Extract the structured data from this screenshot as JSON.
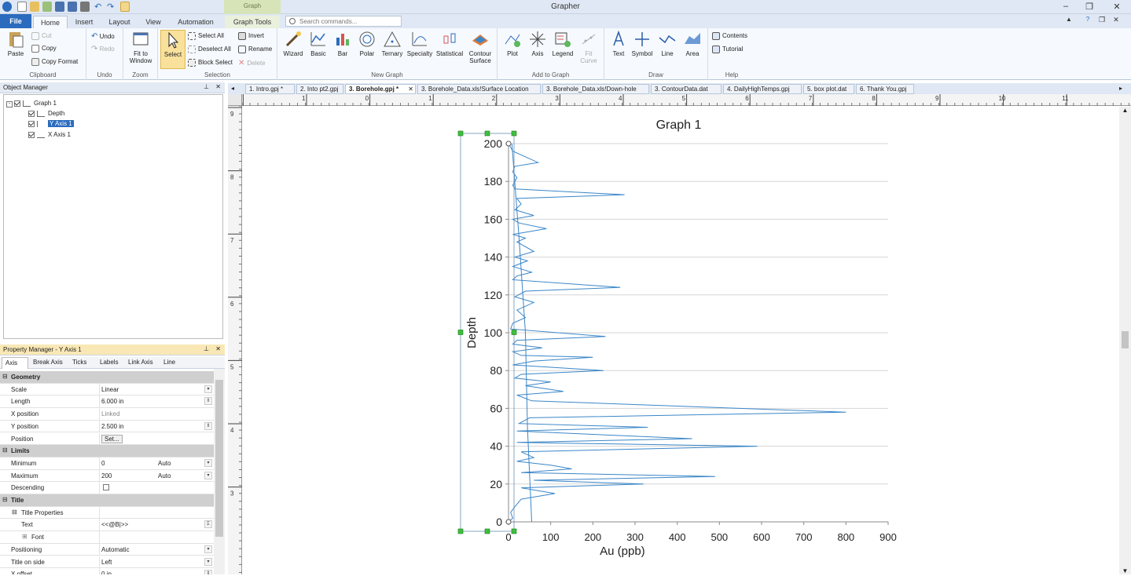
{
  "app": {
    "title": "Grapher",
    "context_tab": "Graph"
  },
  "ribbon_tabs": [
    "File",
    "Home",
    "Insert",
    "Layout",
    "View",
    "Automation",
    "Graph Tools"
  ],
  "search": {
    "placeholder": "Search commands..."
  },
  "ribbon": {
    "clipboard": {
      "label": "Clipboard",
      "paste": "Paste",
      "cut": "Cut",
      "copy": "Copy",
      "copy_format": "Copy Format"
    },
    "undo": {
      "label": "Undo",
      "undo": "Undo",
      "redo": "Redo"
    },
    "zoom": {
      "label": "Zoom",
      "fit_to_window_1": "Fit to",
      "fit_to_window_2": "Window"
    },
    "selection": {
      "label": "Selection",
      "select": "Select",
      "select_all": "Select All",
      "deselect_all": "Deselect All",
      "block_select": "Block Select",
      "invert": "Invert",
      "rename": "Rename",
      "delete": "Delete"
    },
    "new_graph": {
      "label": "New Graph",
      "items": [
        "Wizard",
        "Basic",
        "Bar",
        "Polar",
        "Ternary",
        "Specialty",
        "Statistical",
        "Contour"
      ],
      "contour_sub": "Surface"
    },
    "add_to_graph": {
      "label": "Add to Graph",
      "items": [
        "Plot",
        "Axis",
        "Legend",
        "Fit"
      ],
      "fit_sub": "Curve"
    },
    "draw": {
      "label": "Draw",
      "items": [
        "Text",
        "Symbol",
        "Line",
        "Area"
      ]
    },
    "help": {
      "label": "Help",
      "contents": "Contents",
      "tutorial": "Tutorial"
    }
  },
  "object_manager": {
    "title": "Object Manager",
    "tree": [
      "Graph 1",
      "Depth",
      "Y Axis 1",
      "X Axis 1"
    ]
  },
  "property_manager": {
    "title": "Property Manager - Y Axis 1",
    "tabs": [
      "Axis",
      "Break Axis",
      "Ticks",
      "Labels",
      "Link Axis",
      "Line"
    ],
    "rows": [
      {
        "type": "cat",
        "label": "Geometry"
      },
      {
        "label": "Scale",
        "value": "Linear",
        "dd": true
      },
      {
        "label": "Length",
        "value": "6.000 in",
        "spin": true
      },
      {
        "label": "X position",
        "value": "Linked",
        "muted": true
      },
      {
        "label": "Y position",
        "value": "2.500 in",
        "spin": true
      },
      {
        "label": "Position",
        "value": "Set...",
        "button": true
      },
      {
        "type": "cat",
        "label": "Limits"
      },
      {
        "label": "Minimum",
        "value": "0",
        "value2": "Auto",
        "dd": true
      },
      {
        "label": "Maximum",
        "value": "200",
        "value2": "Auto",
        "dd": true
      },
      {
        "label": "Descending",
        "checkbox": true
      },
      {
        "type": "cat",
        "label": "Title"
      },
      {
        "label": "Title Properties",
        "sub": true
      },
      {
        "label": "Text",
        "value": "<<@B|>>",
        "sigma": true,
        "indent": 2
      },
      {
        "label": "Font",
        "indent": 2,
        "plus": true
      },
      {
        "label": "Positioning",
        "value": "Automatic",
        "dd": true
      },
      {
        "label": "Title on side",
        "value": "Left",
        "dd": true
      },
      {
        "label": "X offset",
        "value": "0 in",
        "spin": true
      }
    ]
  },
  "doc_tabs": [
    "1. Intro.gpj *",
    "2. Into pt2.gpj",
    "3. Borehole.gpj *",
    "3. Borehole_Data.xls!Surface Location",
    "3. Borehole_Data.xls!Down-hole",
    "3. ContourData.dat",
    "4. DailyHighTemps.gpj",
    "5. box plot.dat",
    "6. Thank You.gpj"
  ],
  "ruler": {
    "h_labels": [
      "2",
      "1",
      "0",
      "1",
      "2",
      "3",
      "4",
      "5",
      "6",
      "7",
      "8",
      "9",
      "10",
      "11"
    ],
    "v_labels": [
      "9",
      "8",
      "7",
      "6",
      "5",
      "4",
      "3"
    ]
  },
  "chart_data": {
    "type": "line",
    "title": "Graph 1",
    "xlabel": "Au (ppb)",
    "ylabel": "Depth",
    "xlim": [
      0,
      900
    ],
    "ylim": [
      0,
      200
    ],
    "x_ticks": [
      "0",
      "100",
      "200",
      "300",
      "400",
      "500",
      "600",
      "700",
      "800",
      "900"
    ],
    "y_ticks": [
      "0",
      "20",
      "40",
      "60",
      "80",
      "100",
      "120",
      "140",
      "160",
      "180",
      "200"
    ],
    "grid": true,
    "series": [
      {
        "color": "#3a86c8",
        "points": [
          [
            0,
            200
          ],
          [
            5,
            198
          ],
          [
            10,
            196
          ],
          [
            70,
            190
          ],
          [
            15,
            188
          ],
          [
            10,
            185
          ],
          [
            20,
            182
          ],
          [
            10,
            178
          ],
          [
            15,
            176
          ],
          [
            275,
            173
          ],
          [
            20,
            171
          ],
          [
            30,
            168
          ],
          [
            15,
            165
          ],
          [
            60,
            162
          ],
          [
            10,
            160
          ],
          [
            25,
            158
          ],
          [
            90,
            155
          ],
          [
            10,
            152
          ],
          [
            40,
            150
          ],
          [
            20,
            148
          ],
          [
            60,
            143
          ],
          [
            15,
            140
          ],
          [
            45,
            138
          ],
          [
            10,
            135
          ],
          [
            55,
            132
          ],
          [
            20,
            130
          ],
          [
            10,
            128
          ],
          [
            265,
            124
          ],
          [
            40,
            122
          ],
          [
            15,
            119
          ],
          [
            60,
            116
          ],
          [
            20,
            112
          ],
          [
            40,
            108
          ],
          [
            10,
            105
          ],
          [
            5,
            102
          ],
          [
            230,
            98
          ],
          [
            20,
            96
          ],
          [
            10,
            94
          ],
          [
            80,
            92
          ],
          [
            10,
            90
          ],
          [
            30,
            88
          ],
          [
            200,
            87
          ],
          [
            60,
            85
          ],
          [
            10,
            83
          ],
          [
            225,
            80
          ],
          [
            30,
            78
          ],
          [
            15,
            76
          ],
          [
            100,
            74
          ],
          [
            40,
            72
          ],
          [
            130,
            69
          ],
          [
            20,
            67
          ],
          [
            55,
            64
          ],
          [
            800,
            58
          ],
          [
            50,
            55
          ],
          [
            25,
            52
          ],
          [
            330,
            50
          ],
          [
            20,
            48
          ],
          [
            435,
            44
          ],
          [
            20,
            42
          ],
          [
            590,
            40
          ],
          [
            30,
            37
          ],
          [
            60,
            34
          ],
          [
            20,
            32
          ],
          [
            100,
            30
          ],
          [
            150,
            28
          ],
          [
            30,
            26
          ],
          [
            490,
            24
          ],
          [
            60,
            22
          ],
          [
            320,
            20
          ],
          [
            30,
            18
          ],
          [
            110,
            15
          ],
          [
            30,
            12
          ],
          [
            15,
            8
          ],
          [
            5,
            5
          ],
          [
            10,
            2
          ],
          [
            0,
            0
          ]
        ]
      },
      {
        "color": "#3a86c8",
        "points": [
          [
            8,
            200
          ],
          [
            25,
            150
          ],
          [
            40,
            100
          ],
          [
            45,
            50
          ],
          [
            55,
            0
          ]
        ]
      }
    ]
  }
}
